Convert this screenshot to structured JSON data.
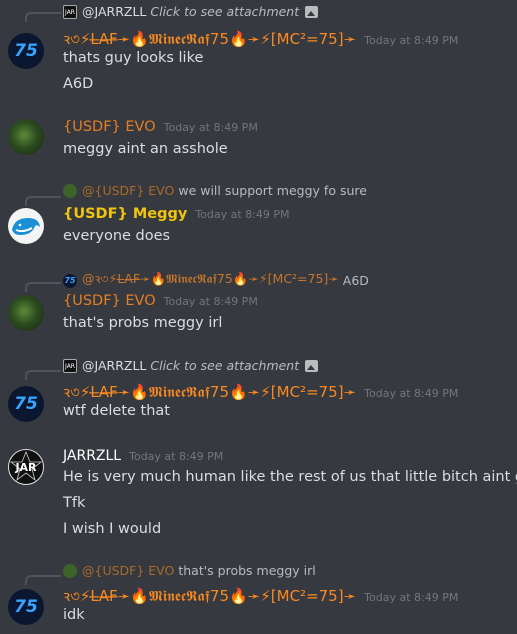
{
  "messages": [
    {
      "reply": {
        "author": "@JARRZLL",
        "text": "Click to see attachment",
        "has_image_icon": true
      },
      "author": "ꝛ৩⚡L̶A̶F̶➛🔥𝕸𝖎𝖓𝖊𝖈𝕽𝖆𝖋75🔥➛⚡[MC²=75]➛",
      "timestamp": "Today at 8:49 PM",
      "lines": [
        "thats guy looks like",
        "A6D"
      ]
    },
    {
      "author": "{USDF} EVO",
      "timestamp": "Today at 8:49 PM",
      "lines": [
        "meggy aint an asshole"
      ]
    },
    {
      "reply": {
        "author": "@{USDF} EVO",
        "text": "we will support meggy fo sure"
      },
      "author": "{USDF} Meggy",
      "timestamp": "Today at 8:49 PM",
      "lines": [
        "everyone does"
      ]
    },
    {
      "reply": {
        "author": "@ꝛ৩⚡L̶A̶F̶➛🔥𝕸𝖎𝖓𝖊𝖈𝕽𝖆𝖋75🔥➛⚡[MC²=75]➛",
        "text": "A6D"
      },
      "author": "{USDF} EVO",
      "timestamp": "Today at 8:49 PM",
      "lines": [
        "that's probs meggy irl"
      ]
    },
    {
      "reply": {
        "author": "@JARRZLL",
        "text": "Click to see attachment",
        "has_image_icon": true
      },
      "author": "ꝛ৩⚡L̶A̶F̶➛🔥𝕸𝖎𝖓𝖊𝖈𝕽𝖆𝖋75🔥➛⚡[MC²=75]➛",
      "timestamp": "Today at 8:49 PM",
      "lines": [
        "wtf delete that"
      ]
    },
    {
      "author": "JARRZLL",
      "timestamp": "Today at 8:49 PM",
      "lines": [
        "He is very much human like the rest of us that little bitch aint god",
        "Tfk",
        "I wish I would"
      ]
    },
    {
      "reply": {
        "author": "@{USDF} EVO",
        "text": "that's probs meggy irl"
      },
      "author": "ꝛ৩⚡L̶A̶F̶➛🔥𝕸𝖎𝖓𝖊𝖈𝕽𝖆𝖋75🔥➛⚡[MC²=75]➛",
      "timestamp": "Today at 8:49 PM",
      "lines": [
        "idk"
      ]
    }
  ],
  "avatars": {
    "laf": "75",
    "jar": "JAR"
  },
  "colors": {
    "background": "#36393f",
    "laf_name": "#f98a21",
    "evo_name": "#e67e22",
    "meggy_name": "#f1c40f",
    "timestamp": "#72767d"
  }
}
